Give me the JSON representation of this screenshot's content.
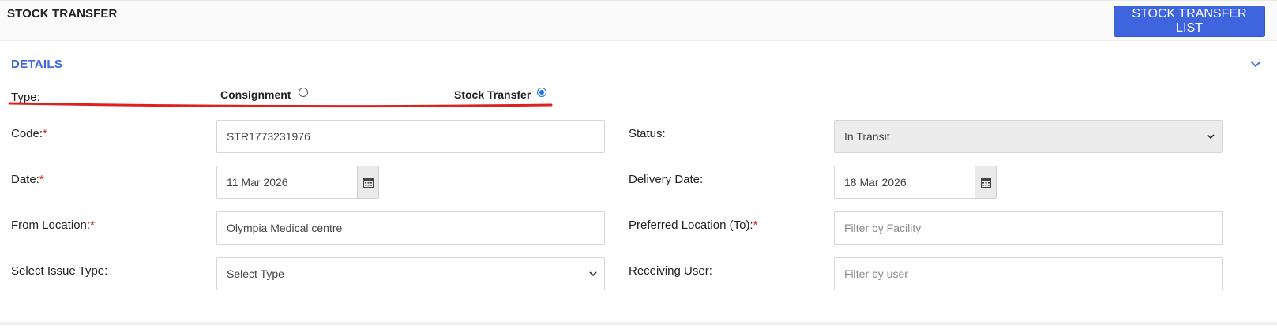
{
  "header": {
    "title": "STOCK TRANSFER",
    "list_button_label": "STOCK TRANSFER LIST"
  },
  "details": {
    "section_title": "DETAILS",
    "type": {
      "label": "Type:",
      "options": [
        {
          "label": "Consignment",
          "checked": false
        },
        {
          "label": "Stock Transfer",
          "checked": true
        }
      ]
    },
    "fields": {
      "code": {
        "label": "Code:",
        "required": "*",
        "value": "STR1773231976"
      },
      "status": {
        "label": "Status:",
        "value": "In Transit"
      },
      "date": {
        "label": "Date:",
        "required": "*",
        "value": "11 Mar 2026"
      },
      "delivery_date": {
        "label": "Delivery Date:",
        "value": "18 Mar 2026"
      },
      "from_location": {
        "label": "From Location:",
        "required": "*",
        "value": "Olympia Medical centre"
      },
      "preferred_location": {
        "label": "Preferred Location (To):",
        "required": "*",
        "placeholder": "Filter by Facility"
      },
      "issue_type": {
        "label": "Select Issue Type:",
        "value": "Select Type"
      },
      "receiving_user": {
        "label": "Receiving User:",
        "placeholder": "Filter by user"
      }
    }
  },
  "colors": {
    "accent": "#3e64de",
    "required": "#e02020",
    "annotation_underline": "#e02020"
  },
  "icons": {
    "calendar": "calendar-icon",
    "chevron": "chevron-down-icon"
  }
}
